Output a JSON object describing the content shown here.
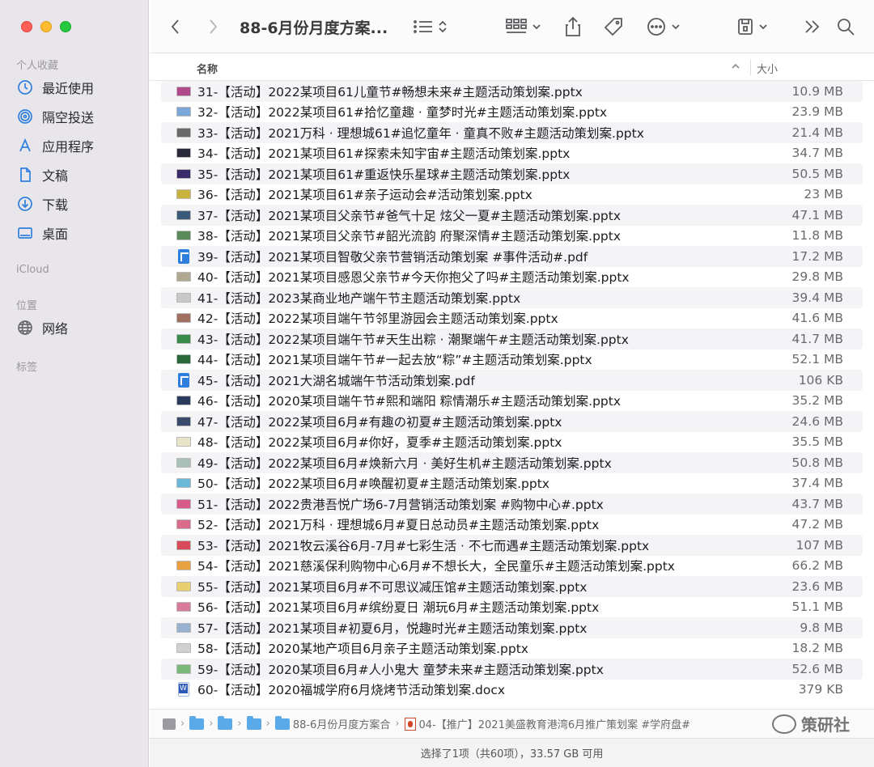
{
  "window": {
    "title": "88-6月份月度方案..."
  },
  "sidebar": {
    "sections": [
      {
        "title": "个人收藏",
        "items": [
          {
            "label": "最近使用",
            "icon": "clock-icon"
          },
          {
            "label": "隔空投送",
            "icon": "airdrop-icon"
          },
          {
            "label": "应用程序",
            "icon": "applications-icon"
          },
          {
            "label": "文稿",
            "icon": "document-icon"
          },
          {
            "label": "下载",
            "icon": "download-icon"
          },
          {
            "label": "桌面",
            "icon": "desktop-icon"
          }
        ]
      },
      {
        "title": "iCloud",
        "items": []
      },
      {
        "title": "位置",
        "items": [
          {
            "label": "网络",
            "icon": "globe-icon"
          }
        ]
      },
      {
        "title": "标签",
        "items": []
      }
    ]
  },
  "columns": {
    "name": "名称",
    "size": "大小"
  },
  "files": [
    {
      "name": "31-【活动】2022某项目61儿童节#畅想未来#主题活动策划案.pptx",
      "size": "10.9 MB",
      "type": "ppt",
      "thumb": "#b04a8c"
    },
    {
      "name": "32-【活动】2022某项目61#拾忆童趣 · 童梦时光#主题活动策划案.pptx",
      "size": "23.9 MB",
      "type": "ppt",
      "thumb": "#7aa6d8"
    },
    {
      "name": "33-【活动】2021万科 · 理想城61#追忆童年 · 童真不败#主题活动策划案.pptx",
      "size": "21.4 MB",
      "type": "ppt",
      "thumb": "#6a6a6a"
    },
    {
      "name": "34-【活动】2021某项目61#探索未知宇宙#主题活动策划案.pptx",
      "size": "34.7 MB",
      "type": "ppt",
      "thumb": "#2a2a3a"
    },
    {
      "name": "35-【活动】2021某项目61#重返快乐星球#主题活动策划案.pptx",
      "size": "50.5 MB",
      "type": "ppt",
      "thumb": "#3a2a6a"
    },
    {
      "name": "36-【活动】2021某项目61#亲子运动会#活动策划案.pptx",
      "size": "23 MB",
      "type": "ppt",
      "thumb": "#c8b43a"
    },
    {
      "name": "37-【活动】2021某项目父亲节#爸气十足 炫父一夏#主题活动策划案.pptx",
      "size": "47.1 MB",
      "type": "ppt",
      "thumb": "#3a5a7a"
    },
    {
      "name": "38-【活动】2021某项目父亲节#韶光流韵 府聚深情#主题活动策划案.pptx",
      "size": "11.8 MB",
      "type": "ppt",
      "thumb": "#5a8a5a"
    },
    {
      "name": "39-【活动】2021某项目智敬父亲节营销活动策划案 #事件活动#.pdf",
      "size": "17.2 MB",
      "type": "pdf",
      "thumb": "#2f7fde"
    },
    {
      "name": "40-【活动】2021某项目感恩父亲节#今天你抱父了吗#主题活动策划案.pptx",
      "size": "29.8 MB",
      "type": "ppt",
      "thumb": "#b0a890"
    },
    {
      "name": "41-【活动】2023某商业地产端午节主题活动策划案.pptx",
      "size": "39.4 MB",
      "type": "ppt",
      "thumb": "#c8c8c8"
    },
    {
      "name": "42-【活动】2022某项目端午节邻里游园会主题活动策划案.pptx",
      "size": "41.6 MB",
      "type": "ppt",
      "thumb": "#a07060"
    },
    {
      "name": "43-【活动】2022某项目端午节#天生出粽 · 潮聚端午#主题活动策划案.pptx",
      "size": "41.7 MB",
      "type": "ppt",
      "thumb": "#3a8a4a"
    },
    {
      "name": "44-【活动】2021某项目端午节#一起去放“粽”#主题活动策划案.pptx",
      "size": "52.1 MB",
      "type": "ppt",
      "thumb": "#2a6a3a"
    },
    {
      "name": "45-【活动】2021大湖名城端午节活动策划案.pdf",
      "size": "106 KB",
      "type": "pdf",
      "thumb": "#2f7fde"
    },
    {
      "name": "46-【活动】2020某项目端午节#熙和端阳 粽情潮乐#主题活动策划案.pptx",
      "size": "35.2 MB",
      "type": "ppt",
      "thumb": "#2a3a5a"
    },
    {
      "name": "47-【活动】2022某项目6月#有趣の初夏#主题活动策划案.pptx",
      "size": "24.6 MB",
      "type": "ppt",
      "thumb": "#3a4a6a"
    },
    {
      "name": "48-【活动】2022某项目6月#你好，夏季#主题活动策划案.pptx",
      "size": "35.5 MB",
      "type": "ppt",
      "thumb": "#e8e4c8"
    },
    {
      "name": "49-【活动】2022某项目6月#焕新六月 · 美好生机#主题活动策划案.pptx",
      "size": "50.8 MB",
      "type": "ppt",
      "thumb": "#a8c0b8"
    },
    {
      "name": "50-【活动】2022某项目6月#唤醒初夏#主题活动策划案.pptx",
      "size": "37.4 MB",
      "type": "ppt",
      "thumb": "#6ab8d8"
    },
    {
      "name": "51-【活动】2022贵港吾悦广场6-7月营销活动策划案 #购物中心#.pptx",
      "size": "43.7 MB",
      "type": "ppt",
      "thumb": "#d85a8a"
    },
    {
      "name": "52-【活动】2021万科 · 理想城6月#夏日总动员#主题活动策划案.pptx",
      "size": "47.2 MB",
      "type": "ppt",
      "thumb": "#d86a8a"
    },
    {
      "name": "53-【活动】2021牧云溪谷6月-7月#七彩生活 · 不七而遇#主题活动策划案.pptx",
      "size": "107 MB",
      "type": "ppt",
      "thumb": "#d84a5a"
    },
    {
      "name": "54-【活动】2021慈溪保利购物中心6月#不想长大，全民童乐#主题活动策划案.pptx",
      "size": "66.2 MB",
      "type": "ppt",
      "thumb": "#e8a040"
    },
    {
      "name": "55-【活动】2021某项目6月#不可思议减压馆#主题活动策划案.pptx",
      "size": "23.6 MB",
      "type": "ppt",
      "thumb": "#e8d070"
    },
    {
      "name": "56-【活动】2021某项目6月#缤纷夏日 潮玩6月#主题活动策划案.pptx",
      "size": "51.1 MB",
      "type": "ppt",
      "thumb": "#d87a9a"
    },
    {
      "name": "57-【活动】2021某项目#初夏6月，悦趣时光#主题活动策划案.pptx",
      "size": "9.8 MB",
      "type": "ppt",
      "thumb": "#9ab0d0"
    },
    {
      "name": "58-【活动】2020某地产项目6月亲子主题活动策划案.pptx",
      "size": "18.2 MB",
      "type": "ppt",
      "thumb": "#d0d0d0"
    },
    {
      "name": "59-【活动】2020某项目6月#人小鬼大 童梦未来#主题活动策划案.pptx",
      "size": "52.6 MB",
      "type": "ppt",
      "thumb": "#7ab87a"
    },
    {
      "name": "60-【活动】2020福城学府6月烧烤节活动策划案.docx",
      "size": "379 KB",
      "type": "doc",
      "thumb": "#2b5bb5"
    }
  ],
  "pathbar": {
    "folder": "88-6月份月度方案合",
    "file": "04-【推广】2021美盛教育港湾6月推广策划案 #学府盘#"
  },
  "watermark": "策研社",
  "status": "选择了1项（共60项），33.57 GB 可用"
}
